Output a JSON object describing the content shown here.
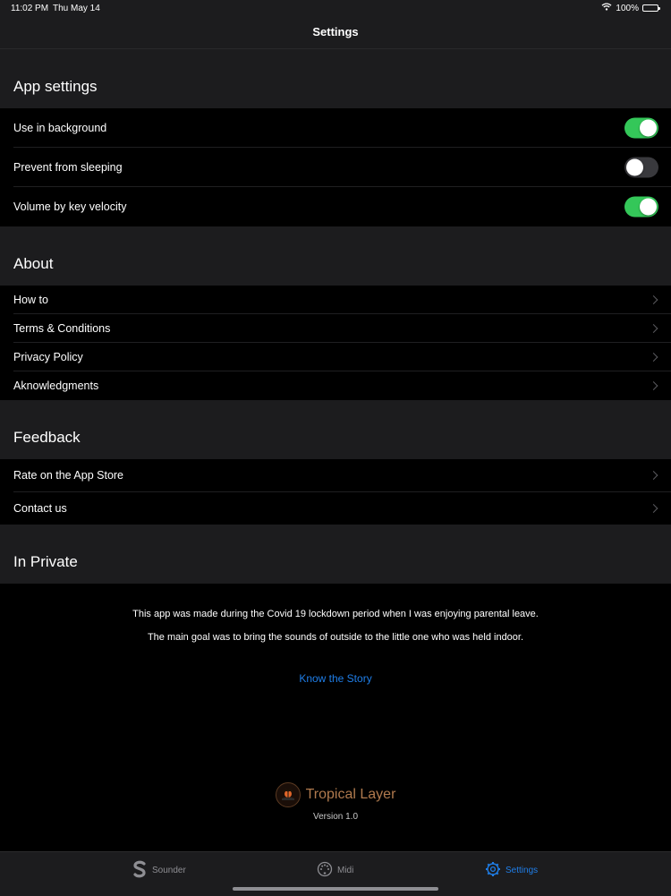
{
  "status_bar": {
    "time": "11:02 PM",
    "date": "Thu May 14",
    "battery": "100%"
  },
  "nav": {
    "title": "Settings"
  },
  "sections": {
    "app_settings": {
      "title": "App settings",
      "items": [
        {
          "label": "Use in background",
          "on": true
        },
        {
          "label": "Prevent from sleeping",
          "on": false
        },
        {
          "label": "Volume by key velocity",
          "on": true
        }
      ]
    },
    "about": {
      "title": "About",
      "items": [
        {
          "label": "How to"
        },
        {
          "label": "Terms & Conditions"
        },
        {
          "label": "Privacy Policy"
        },
        {
          "label": "Aknowledgments"
        }
      ]
    },
    "feedback": {
      "title": "Feedback",
      "items": [
        {
          "label": "Rate on the App Store"
        },
        {
          "label": "Contact us"
        }
      ]
    },
    "in_private": {
      "title": "In Private",
      "paragraph1": "This app was made during the Covid 19 lockdown period when I was enjoying parental leave.",
      "paragraph2": "The main goal was to bring the sounds of outside to the little one who was held indoor.",
      "link": "Know the Story",
      "brand": "Tropical Layer",
      "version": "Version 1.0"
    }
  },
  "tabs": [
    {
      "label": "Sounder",
      "icon": "sounder-icon",
      "active": false
    },
    {
      "label": "Midi",
      "icon": "midi-icon",
      "active": false
    },
    {
      "label": "Settings",
      "icon": "gear-icon",
      "active": true
    }
  ],
  "colors": {
    "accent": "#1f7ee8",
    "toggle_on": "#34c759",
    "toggle_off": "#39393d",
    "background": "#000000",
    "header_background": "#1c1c1e"
  }
}
